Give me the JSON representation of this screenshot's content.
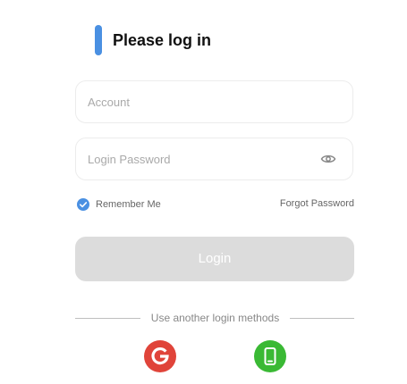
{
  "header": {
    "title": "Please log in",
    "accent_color": "#4a90e2"
  },
  "form": {
    "account": {
      "placeholder": "Account",
      "value": ""
    },
    "password": {
      "placeholder": "Login Password",
      "value": "",
      "toggle_icon": "eye-icon"
    },
    "remember_me": {
      "label": "Remember Me",
      "checked": true
    },
    "forgot_password_label": "Forgot Password",
    "login_button_label": "Login"
  },
  "alternate_login": {
    "divider_text": "Use another login methods",
    "methods": [
      {
        "icon": "google-icon",
        "color": "#e0443a"
      },
      {
        "icon": "phone-icon",
        "color": "#3ab934"
      }
    ]
  }
}
